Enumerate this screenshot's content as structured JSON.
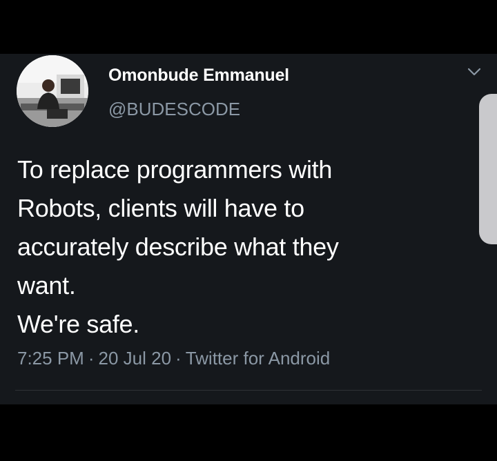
{
  "tweet": {
    "display_name": "Omonbude Emmanuel",
    "handle": "@BUDESCODE",
    "text_lines": [
      "To replace programmers with",
      "Robots, clients will have to",
      "accurately describe what they",
      "want.",
      "We're safe."
    ],
    "time": "7:25 PM",
    "date": "20 Jul 20",
    "source": "Twitter for Android",
    "separator": "·"
  },
  "icons": {
    "avatar": "profile-photo",
    "menu": "chevron-down-icon"
  },
  "colors": {
    "card_background": "#15181c",
    "outer_background": "#000000",
    "primary_text": "#ffffff",
    "secondary_text": "#8b98a5",
    "divider": "#2f3336"
  }
}
